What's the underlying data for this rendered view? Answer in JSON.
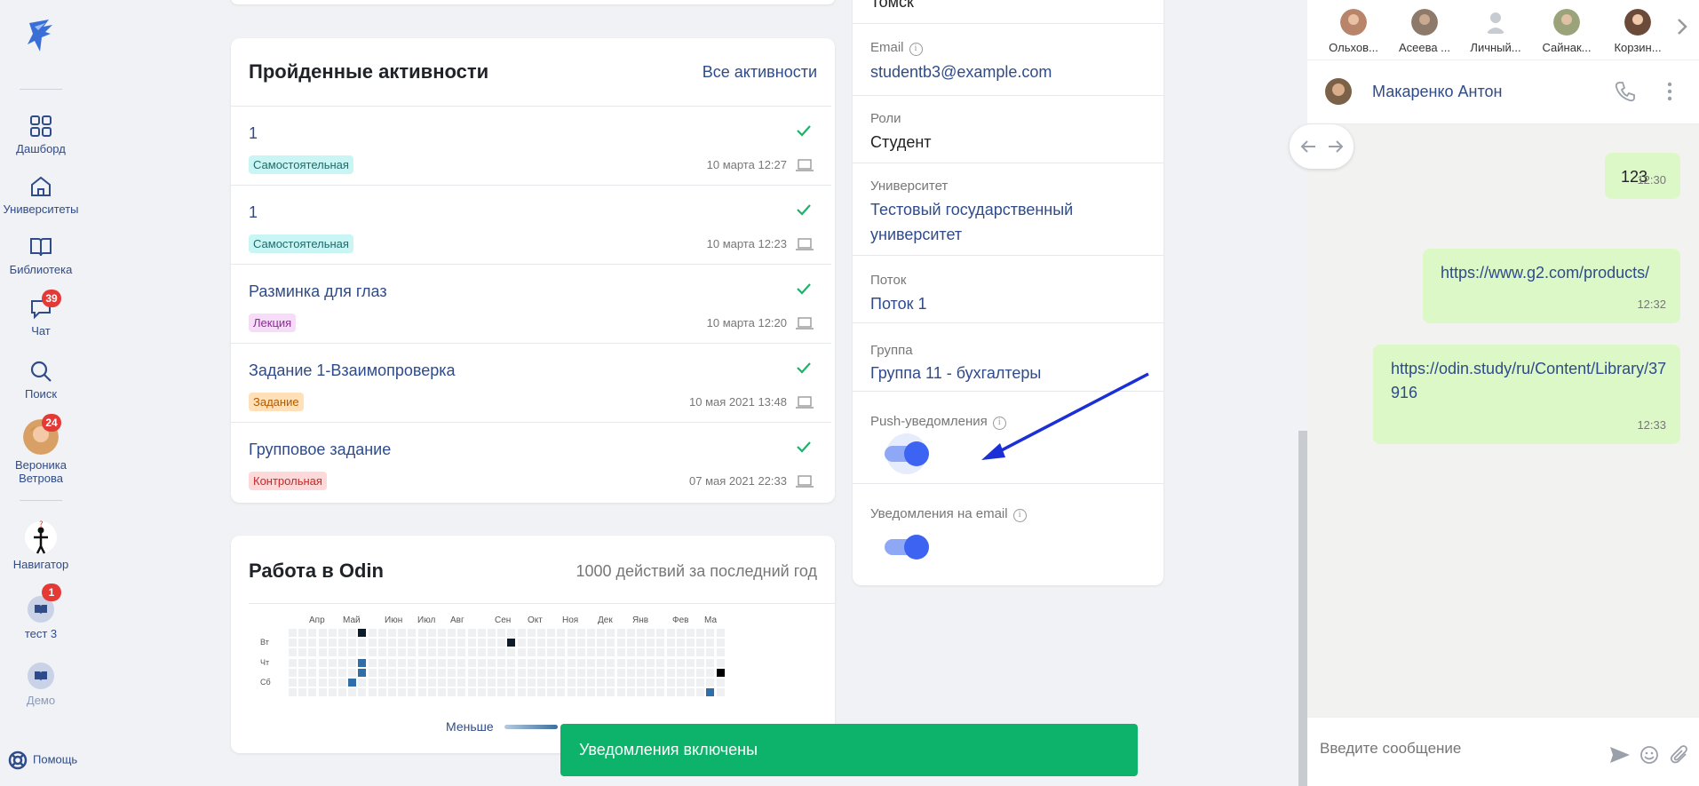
{
  "sidebar": {
    "items": [
      {
        "label": "Дашборд",
        "icon": "dashboard-icon"
      },
      {
        "label": "Университеты",
        "icon": "university-icon"
      },
      {
        "label": "Библиотека",
        "icon": "book-icon"
      },
      {
        "label": "Чат",
        "icon": "chat-icon",
        "badge": "39"
      },
      {
        "label": "Поиск",
        "icon": "search-icon"
      },
      {
        "label": "Вероника Ветрова",
        "icon": "avatar",
        "badge": "24"
      },
      {
        "label": "Навигатор",
        "icon": "navigator-icon"
      },
      {
        "label": "тест 3",
        "icon": "course-icon",
        "badge": "1"
      },
      {
        "label": "Демо",
        "icon": "course-icon"
      }
    ],
    "help": "Помощь"
  },
  "activities": {
    "title": "Пройденные активности",
    "all_link": "Все активности",
    "items": [
      {
        "name": "1",
        "tag": "Самостоятельная",
        "date": "10 марта 12:27"
      },
      {
        "name": "1",
        "tag": "Самостоятельная",
        "date": "10 марта 12:23"
      },
      {
        "name": "Разминка для глаз",
        "tag": "Лекция",
        "date": "10 марта 12:20"
      },
      {
        "name": "Задание 1-Взаимопроверка",
        "tag": "Задание",
        "date": "10 мая 2021 13:48"
      },
      {
        "name": "Групповое задание",
        "tag": "Контрольная",
        "date": "07 мая 2021 22:33"
      }
    ]
  },
  "work": {
    "title": "Работа в Odin",
    "subtitle": "1000 действий за последний год",
    "months": [
      "Апр",
      "Май",
      "Июн",
      "Июл",
      "Авг",
      "Сен",
      "Окт",
      "Ноя",
      "Дек",
      "Янв",
      "Фев",
      "Ма"
    ],
    "days": [
      "Вт",
      "Чт",
      "Сб"
    ],
    "legend_less": "Меньше"
  },
  "profile": {
    "city": "Томск",
    "email_label": "Email",
    "email": "studentb3@example.com",
    "roles_label": "Роли",
    "roles": "Студент",
    "university_label": "Университет",
    "university": "Тестовый государственный университет",
    "stream_label": "Поток",
    "stream": "Поток 1",
    "group_label": "Группа",
    "group": "Группа 11 - бухгалтеры",
    "push_label": "Push-уведомления",
    "push_enabled": true,
    "email_notif_label": "Уведомления на email",
    "email_notif_enabled": true
  },
  "chat": {
    "contacts": [
      "Ольхов...",
      "Асеева ...",
      "Личный...",
      "Сайнак...",
      "Корзин..."
    ],
    "active_name": "Макаренко Антон",
    "messages": [
      {
        "text": "123",
        "time": "12:30"
      },
      {
        "text": "https://www.g2.com/products/",
        "time": "12:32"
      },
      {
        "text": "https://odin.study/ru/Content/Library/37916",
        "time": "12:33"
      }
    ],
    "input_placeholder": "Введите сообщение"
  },
  "toast": "Уведомления включены",
  "colors": {
    "accent": "#2f4b8a",
    "toggle": "#3d63f2",
    "toast": "#0db36a",
    "badge": "#e53935",
    "bubble": "#dcf8c6"
  }
}
